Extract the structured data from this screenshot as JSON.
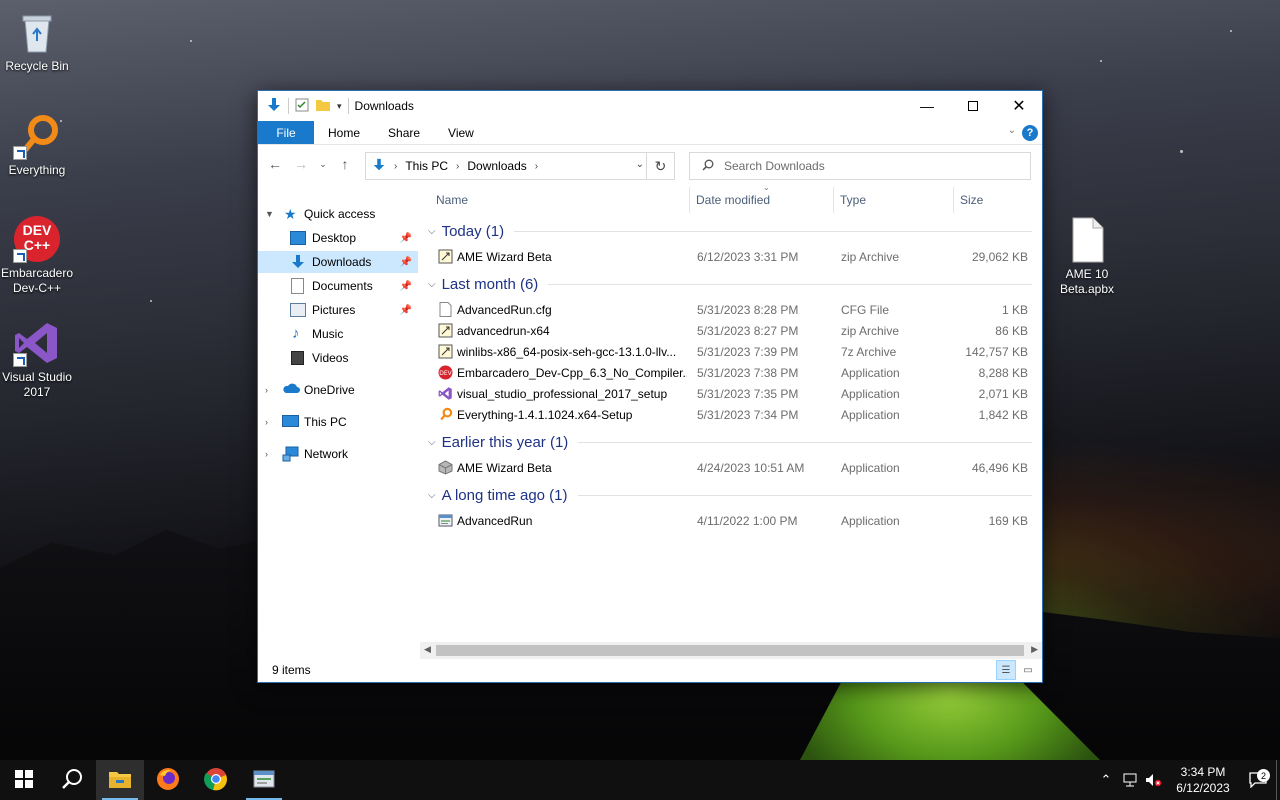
{
  "desktop": {
    "icons": [
      {
        "label": "Recycle Bin"
      },
      {
        "label": "Everything"
      },
      {
        "label": "Embarcadero Dev-C++",
        "logo_text": "DEV C++"
      },
      {
        "label": "Visual Studio 2017"
      },
      {
        "label": "AME 10 Beta.apbx"
      }
    ]
  },
  "window": {
    "title": "Downloads",
    "ribbon_tabs": [
      "File",
      "Home",
      "Share",
      "View"
    ],
    "help_label": "?",
    "address": {
      "crumbs": [
        "This PC",
        "Downloads"
      ]
    },
    "search_placeholder": "Search Downloads",
    "columns": {
      "name": "Name",
      "date": "Date modified",
      "type": "Type",
      "size": "Size"
    },
    "nav_pane": {
      "quick_access": "Quick access",
      "quick_items": [
        "Desktop",
        "Downloads",
        "Documents",
        "Pictures",
        "Music",
        "Videos"
      ],
      "onedrive": "OneDrive",
      "this_pc": "This PC",
      "network": "Network"
    },
    "groups": [
      {
        "title": "Today (1)",
        "files": [
          {
            "name": "AME Wizard Beta",
            "date": "6/12/2023 3:31 PM",
            "type": "zip Archive",
            "size": "29,062 KB"
          }
        ]
      },
      {
        "title": "Last month (6)",
        "files": [
          {
            "name": "AdvancedRun.cfg",
            "date": "5/31/2023 8:28 PM",
            "type": "CFG File",
            "size": "1 KB"
          },
          {
            "name": "advancedrun-x64",
            "date": "5/31/2023 8:27 PM",
            "type": "zip Archive",
            "size": "86 KB"
          },
          {
            "name": "winlibs-x86_64-posix-seh-gcc-13.1.0-llv...",
            "date": "5/31/2023 7:39 PM",
            "type": "7z Archive",
            "size": "142,757 KB"
          },
          {
            "name": "Embarcadero_Dev-Cpp_6.3_No_Compiler...",
            "date": "5/31/2023 7:38 PM",
            "type": "Application",
            "size": "8,288 KB"
          },
          {
            "name": "visual_studio_professional_2017_setup",
            "date": "5/31/2023 7:35 PM",
            "type": "Application",
            "size": "2,071 KB"
          },
          {
            "name": "Everything-1.4.1.1024.x64-Setup",
            "date": "5/31/2023 7:34 PM",
            "type": "Application",
            "size": "1,842 KB"
          }
        ]
      },
      {
        "title": "Earlier this year (1)",
        "files": [
          {
            "name": "AME Wizard Beta",
            "date": "4/24/2023 10:51 AM",
            "type": "Application",
            "size": "46,496 KB"
          }
        ]
      },
      {
        "title": "A long time ago (1)",
        "files": [
          {
            "name": "AdvancedRun",
            "date": "4/11/2022 1:00 PM",
            "type": "Application",
            "size": "169 KB"
          }
        ]
      }
    ],
    "status": "9 items"
  },
  "taskbar": {
    "clock_time": "3:34 PM",
    "clock_date": "6/12/2023",
    "notification_count": "2"
  },
  "colors": {
    "accent": "#1979ca",
    "selection": "#cce8ff",
    "group_header": "#1e3287"
  }
}
